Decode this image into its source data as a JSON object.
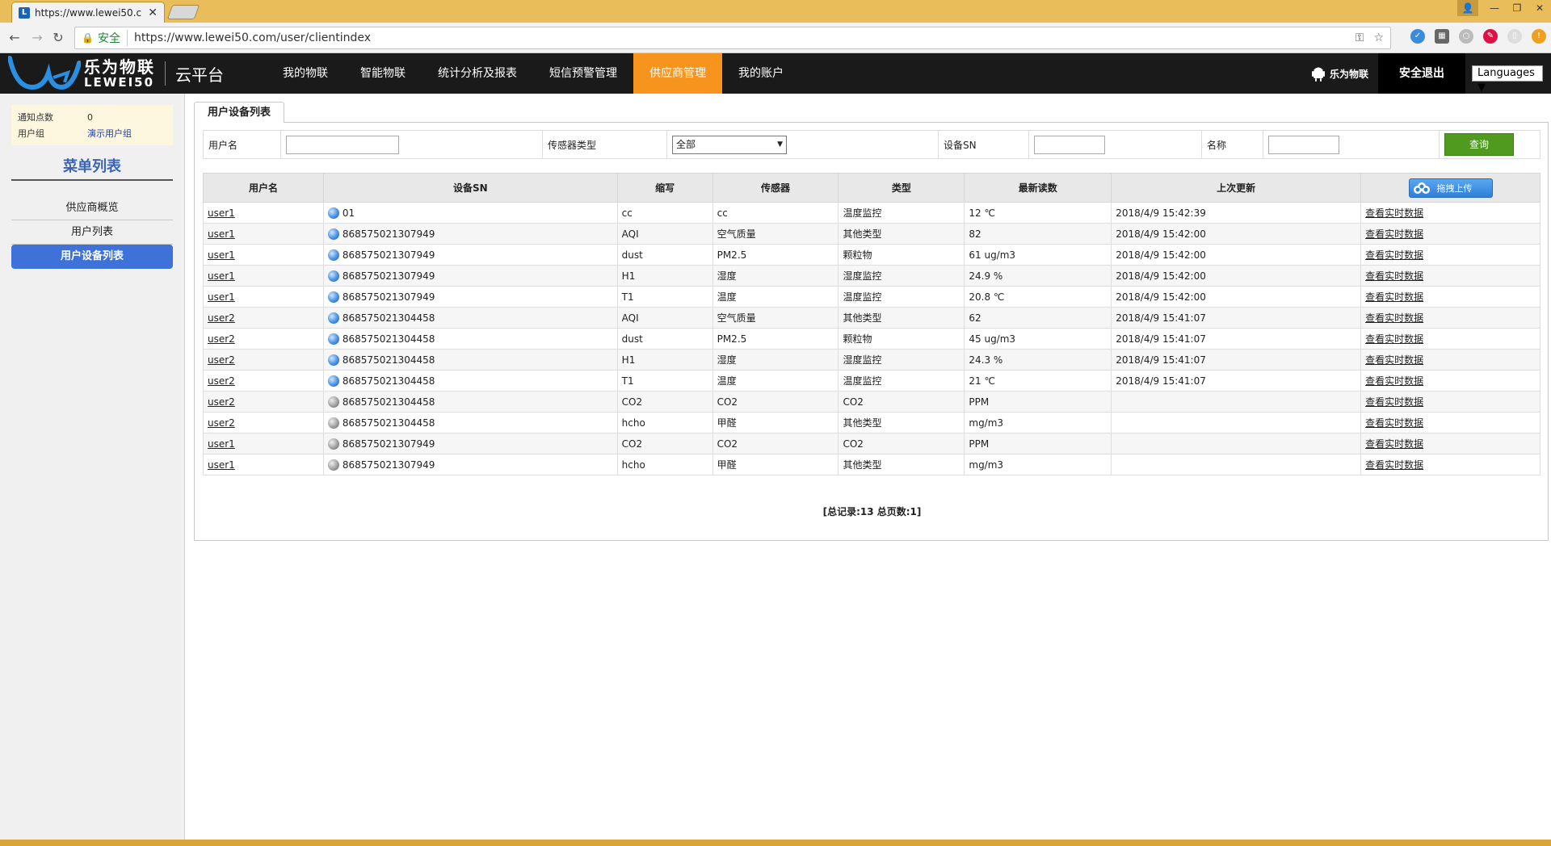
{
  "browser": {
    "tab_title": "https://www.lewei50.c",
    "secure_label": "安全",
    "url": "https://www.lewei50.com/user/clientindex"
  },
  "site": {
    "logo_cn": "乐为物联",
    "logo_en": "LEWEI50",
    "platform": "云平台",
    "nav": [
      "我的物联",
      "智能物联",
      "统计分析及报表",
      "短信预警管理",
      "供应商管理",
      "我的账户"
    ],
    "active_nav": 4,
    "android_label": "乐为物联",
    "logout": "安全退出",
    "languages": "Languages"
  },
  "sidebar": {
    "notice_key": "通知点数",
    "notice_val": "0",
    "group_key": "用户组",
    "group_val": "演示用户组",
    "menu_title": "菜单列表",
    "items": [
      "供应商概览",
      "用户列表",
      "用户设备列表"
    ],
    "active_index": 2
  },
  "content": {
    "tab_label": "用户设备列表",
    "filter": {
      "username_label": "用户名",
      "sensor_type_label": "传感器类型",
      "sensor_type_value": "全部",
      "sn_label": "设备SN",
      "name_label": "名称",
      "query": "查询"
    },
    "columns": [
      "用户名",
      "设备SN",
      "缩写",
      "传感器",
      "类型",
      "最新读数",
      "上次更新"
    ],
    "upload_label": "拖拽上传",
    "action_label": "查看实时数据",
    "rows": [
      {
        "user": "user1",
        "sn": "01",
        "online": true,
        "abbr": "cc",
        "sensor": "cc",
        "type": "温度监控",
        "reading": "12 ℃",
        "updated": "2018/4/9 15:42:39"
      },
      {
        "user": "user1",
        "sn": "868575021307949",
        "online": true,
        "abbr": "AQI",
        "sensor": "空气质量",
        "type": "其他类型",
        "reading": "82",
        "updated": "2018/4/9 15:42:00"
      },
      {
        "user": "user1",
        "sn": "868575021307949",
        "online": true,
        "abbr": "dust",
        "sensor": "PM2.5",
        "type": "颗粒物",
        "reading": "61 ug/m3",
        "updated": "2018/4/9 15:42:00"
      },
      {
        "user": "user1",
        "sn": "868575021307949",
        "online": true,
        "abbr": "H1",
        "sensor": "湿度",
        "type": "湿度监控",
        "reading": "24.9 %",
        "updated": "2018/4/9 15:42:00"
      },
      {
        "user": "user1",
        "sn": "868575021307949",
        "online": true,
        "abbr": "T1",
        "sensor": "温度",
        "type": "温度监控",
        "reading": "20.8 ℃",
        "updated": "2018/4/9 15:42:00"
      },
      {
        "user": "user2",
        "sn": "868575021304458",
        "online": true,
        "abbr": "AQI",
        "sensor": "空气质量",
        "type": "其他类型",
        "reading": "62",
        "updated": "2018/4/9 15:41:07"
      },
      {
        "user": "user2",
        "sn": "868575021304458",
        "online": true,
        "abbr": "dust",
        "sensor": "PM2.5",
        "type": "颗粒物",
        "reading": "45 ug/m3",
        "updated": "2018/4/9 15:41:07"
      },
      {
        "user": "user2",
        "sn": "868575021304458",
        "online": true,
        "abbr": "H1",
        "sensor": "湿度",
        "type": "湿度监控",
        "reading": "24.3 %",
        "updated": "2018/4/9 15:41:07"
      },
      {
        "user": "user2",
        "sn": "868575021304458",
        "online": true,
        "abbr": "T1",
        "sensor": "温度",
        "type": "温度监控",
        "reading": "21 ℃",
        "updated": "2018/4/9 15:41:07"
      },
      {
        "user": "user2",
        "sn": "868575021304458",
        "online": false,
        "abbr": "CO2",
        "sensor": "CO2",
        "type": "CO2",
        "reading": "PPM",
        "updated": ""
      },
      {
        "user": "user2",
        "sn": "868575021304458",
        "online": false,
        "abbr": "hcho",
        "sensor": "甲醛",
        "type": "其他类型",
        "reading": "mg/m3",
        "updated": ""
      },
      {
        "user": "user1",
        "sn": "868575021307949",
        "online": false,
        "abbr": "CO2",
        "sensor": "CO2",
        "type": "CO2",
        "reading": "PPM",
        "updated": ""
      },
      {
        "user": "user1",
        "sn": "868575021307949",
        "online": false,
        "abbr": "hcho",
        "sensor": "甲醛",
        "type": "其他类型",
        "reading": "mg/m3",
        "updated": ""
      }
    ],
    "pager": "[总记录:13 总页数:1]"
  },
  "colors": {
    "nav_active": "#f7941d",
    "sidebar_active": "#3e72d8",
    "query_button": "#4f9a1f"
  }
}
